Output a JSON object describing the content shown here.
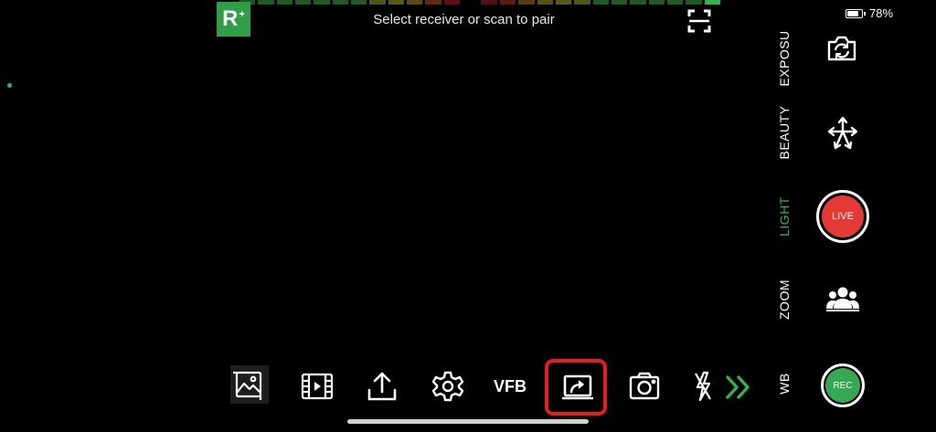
{
  "status": {
    "pair_message": "Select receiver or scan to pair",
    "battery_percent": "78%",
    "battery_level": 0.78
  },
  "logo": {
    "letter": "R",
    "superscript": "+"
  },
  "meter": {
    "segment_colors": [
      "#1f5a24",
      "#1f5a24",
      "#1f5a24",
      "#1f5a24",
      "#1f5a24",
      "#1f5a24",
      "#1f5a24",
      "#4a5a14",
      "#5a5a14",
      "#5e4a10",
      "#5e2a10",
      "#5e1010",
      "#000000",
      "#4e1010",
      "#5e1a10",
      "#5e3a10",
      "#5e4e10",
      "#5a5a14",
      "#4a5a14",
      "#1f5a24",
      "#1f5a24",
      "#1f5a24",
      "#1f5a24",
      "#1f5a24",
      "#1f5a24",
      "#31b44b"
    ]
  },
  "modes": [
    {
      "label": "EXPOSU",
      "active": false
    },
    {
      "label": "BEAUTY",
      "active": false
    },
    {
      "label": "LIGHT",
      "active": true
    },
    {
      "label": "ZOOM",
      "active": false
    },
    {
      "label": "WB",
      "active": false
    }
  ],
  "buttons": {
    "live_label": "LIVE",
    "rec_label": "REC",
    "vfb_label": "VFB"
  },
  "colors": {
    "accent_green": "#31b44b",
    "live_red": "#e53935",
    "rec_green": "#34a853",
    "highlight_red": "#e81c1c"
  },
  "icons": {
    "top": [
      "scan-frame-icon"
    ],
    "right": [
      "camera-flip-icon",
      "transform-arrows-icon",
      "group-people-icon"
    ],
    "bottom": [
      "gallery-icon",
      "video-library-icon",
      "upload-icon",
      "gear-icon",
      "screen-share-icon",
      "camera-icon",
      "flash-off-icon",
      "double-chevron-right-icon"
    ]
  }
}
